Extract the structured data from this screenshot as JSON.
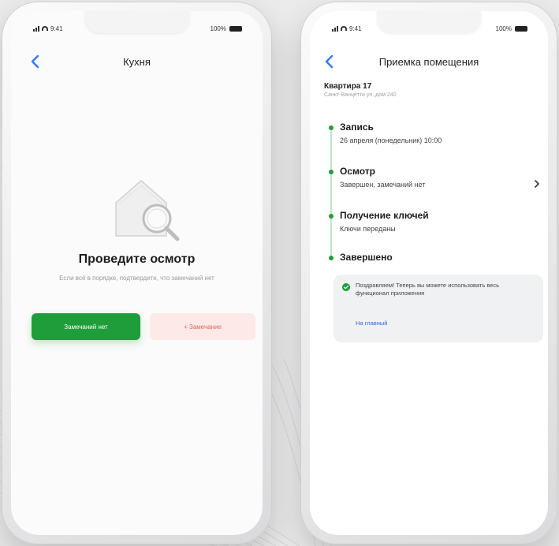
{
  "status_bar": {
    "time": "9:41",
    "battery": "100%"
  },
  "left_screen": {
    "title": "Кухня",
    "heading": "Проведите осмотр",
    "hint": "Если всё в порядке, подтвердите, что замечаний нет",
    "primary_button": "Замечаний нет",
    "secondary_button": "+ Замечание"
  },
  "right_screen": {
    "title": "Приемка помещения",
    "apartment": "Квартира 17",
    "address": "Санкт-Ванцетти ул, дом 240",
    "steps": [
      {
        "title": "Запись",
        "subtitle": "26 апреля (понедельник) 10:00"
      },
      {
        "title": "Осмотр",
        "subtitle": "Завершен, замечаний нет"
      },
      {
        "title": "Получение ключей",
        "subtitle": "Ключи переданы"
      },
      {
        "title": "Завершено",
        "subtitle": ""
      }
    ],
    "congrats_text": "Поздравляем! Теперь вы можете использовать весь функционал приложения",
    "congrats_link": "На главный"
  },
  "colors": {
    "accent_green": "#1f9d3a",
    "timeline_light": "#bfe6c9",
    "danger_bg": "#fde9e7",
    "danger_text": "#e0685a",
    "link_blue": "#2f6fd6",
    "back_blue": "#2f7cf6"
  },
  "icons": {
    "back": "chevron-left-icon",
    "forward": "chevron-right-icon",
    "check": "check-circle-icon",
    "empty_state": "house-magnifier-icon"
  }
}
